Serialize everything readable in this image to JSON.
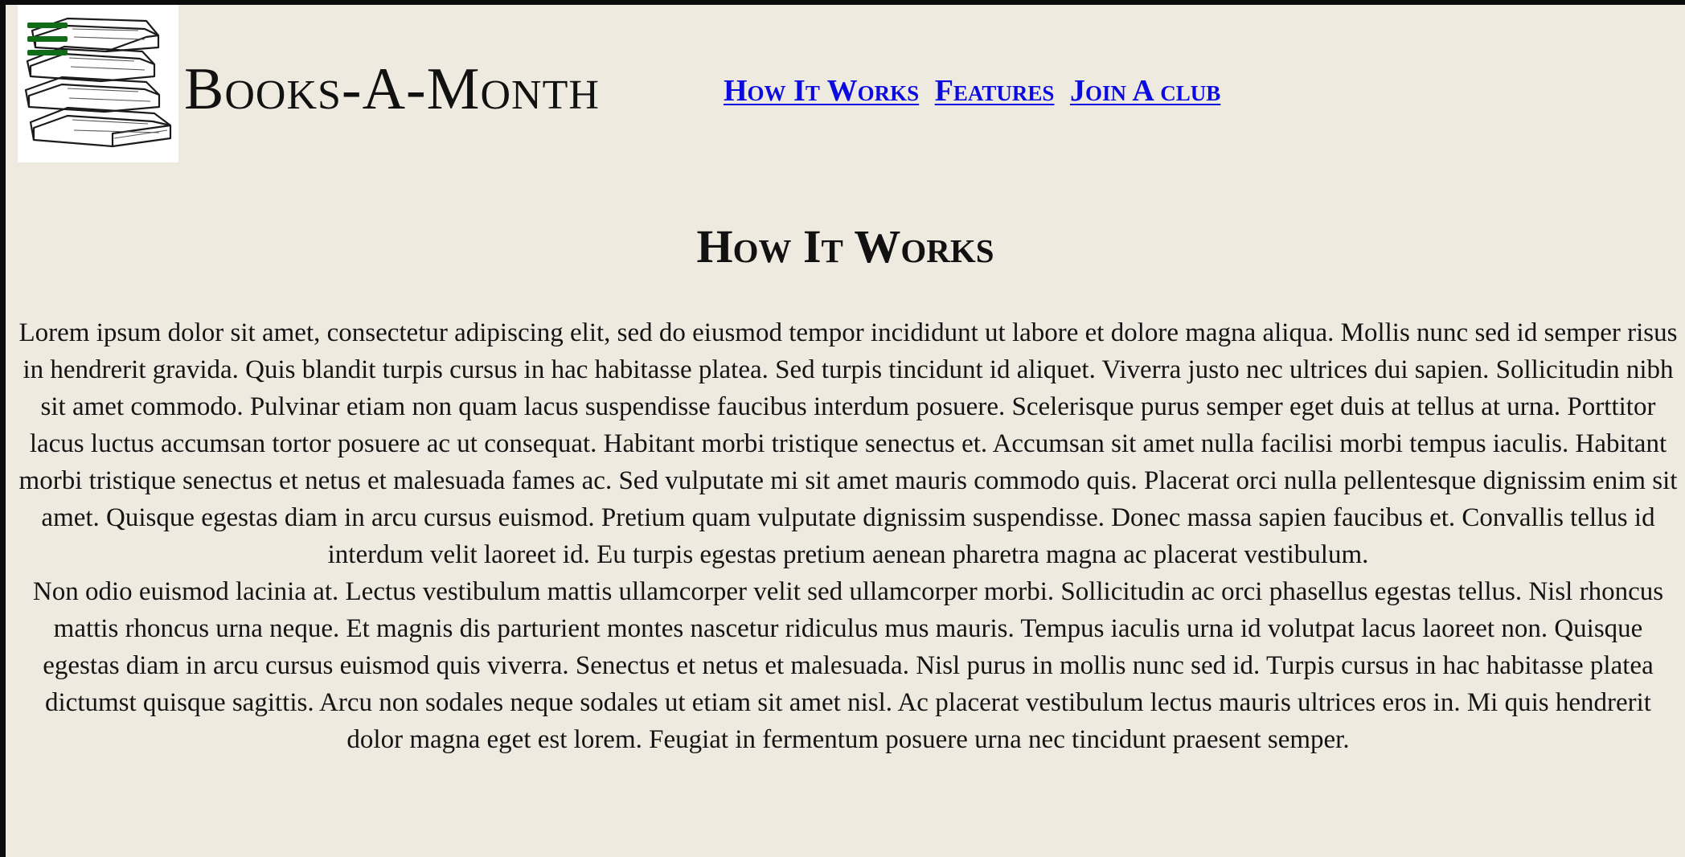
{
  "header": {
    "site_title": "Books-A-Month",
    "menu_icon": "hamburger-menu-icon",
    "logo_icon": "books-stack-icon",
    "brand_color": "#116b17",
    "link_color": "#0b0bdf",
    "nav": [
      {
        "label": "How It Works"
      },
      {
        "label": "Features"
      },
      {
        "label": "Join A club"
      }
    ]
  },
  "main": {
    "section_title": "How It Works",
    "paragraphs": [
      "Lorem ipsum dolor sit amet, consectetur adipiscing elit, sed do eiusmod tempor incididunt ut labore et dolore magna aliqua. Mollis nunc sed id semper risus in hendrerit gravida. Quis blandit turpis cursus in hac habitasse platea. Sed turpis tincidunt id aliquet. Viverra justo nec ultrices dui sapien. Sollicitudin nibh sit amet commodo. Pulvinar etiam non quam lacus suspendisse faucibus interdum posuere. Scelerisque purus semper eget duis at tellus at urna. Porttitor lacus luctus accumsan tortor posuere ac ut consequat. Habitant morbi tristique senectus et. Accumsan sit amet nulla facilisi morbi tempus iaculis. Habitant morbi tristique senectus et netus et malesuada fames ac. Sed vulputate mi sit amet mauris commodo quis. Placerat orci nulla pellentesque dignissim enim sit amet. Quisque egestas diam in arcu cursus euismod. Pretium quam vulputate dignissim suspendisse. Donec massa sapien faucibus et. Convallis tellus id interdum velit laoreet id. Eu turpis egestas pretium aenean pharetra magna ac placerat vestibulum.",
      "Non odio euismod lacinia at. Lectus vestibulum mattis ullamcorper velit sed ullamcorper morbi. Sollicitudin ac orci phasellus egestas tellus. Nisl rhoncus mattis rhoncus urna neque. Et magnis dis parturient montes nascetur ridiculus mus mauris. Tempus iaculis urna id volutpat lacus laoreet non. Quisque egestas diam in arcu cursus euismod quis viverra. Senectus et netus et malesuada. Nisl purus in mollis nunc sed id. Turpis cursus in hac habitasse platea dictumst quisque sagittis. Arcu non sodales neque sodales ut etiam sit amet nisl. Ac placerat vestibulum lectus mauris ultrices eros in. Mi quis hendrerit dolor magna eget est lorem. Feugiat in fermentum posuere urna nec tincidunt praesent semper."
    ]
  }
}
